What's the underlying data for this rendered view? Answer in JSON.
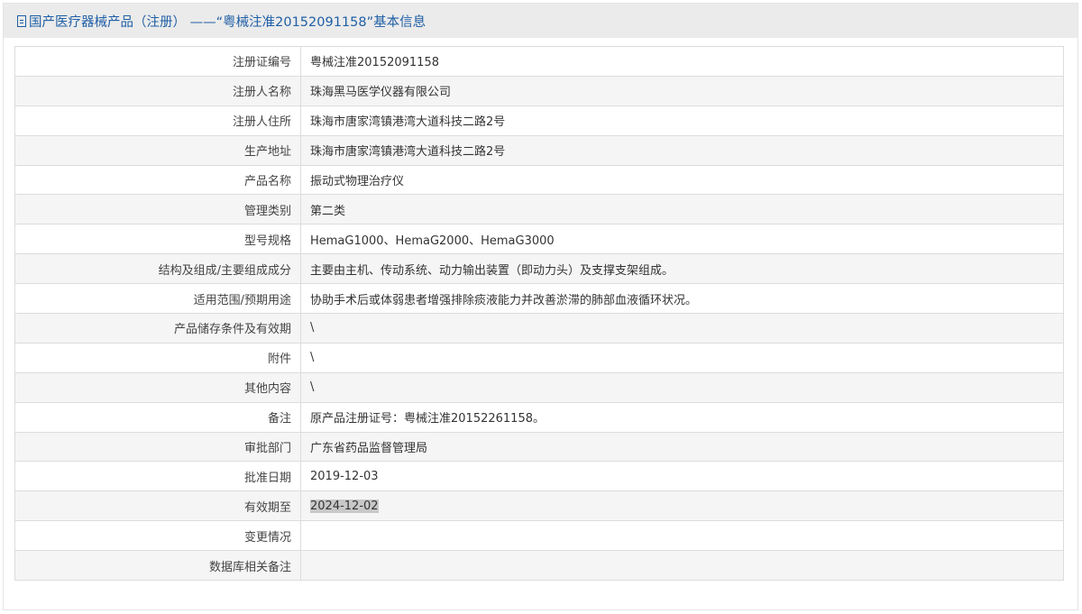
{
  "header": {
    "icon": "document-icon",
    "title": "国产医疗器械产品（注册） ——“粤械注准20152091158”基本信息"
  },
  "rows": [
    {
      "label": "注册证编号",
      "value": "粤械注准20152091158"
    },
    {
      "label": "注册人名称",
      "value": "珠海黑马医学仪器有限公司"
    },
    {
      "label": "注册人住所",
      "value": "珠海市唐家湾镇港湾大道科技二路2号"
    },
    {
      "label": "生产地址",
      "value": "珠海市唐家湾镇港湾大道科技二路2号"
    },
    {
      "label": "产品名称",
      "value": "振动式物理治疗仪"
    },
    {
      "label": "管理类别",
      "value": "第二类"
    },
    {
      "label": "型号规格",
      "value": "HemaG1000、HemaG2000、HemaG3000"
    },
    {
      "label": "结构及组成/主要组成成分",
      "value": "主要由主机、传动系统、动力输出装置（即动力头）及支撑支架组成。"
    },
    {
      "label": "适用范围/预期用途",
      "value": "协助手术后或体弱患者增强排除痰液能力并改善淤滞的肺部血液循环状况。"
    },
    {
      "label": "产品储存条件及有效期",
      "value": "\\"
    },
    {
      "label": "附件",
      "value": "\\"
    },
    {
      "label": "其他内容",
      "value": "\\"
    },
    {
      "label": "备注",
      "value": "原产品注册证号：粤械注准20152261158。"
    },
    {
      "label": "审批部门",
      "value": "广东省药品监督管理局"
    },
    {
      "label": "批准日期",
      "value": "2019-12-03"
    },
    {
      "label": "有效期至",
      "value": "2024-12-02"
    },
    {
      "label": "变更情况",
      "value": ""
    },
    {
      "label": "数据库相关备注",
      "value": ""
    }
  ]
}
